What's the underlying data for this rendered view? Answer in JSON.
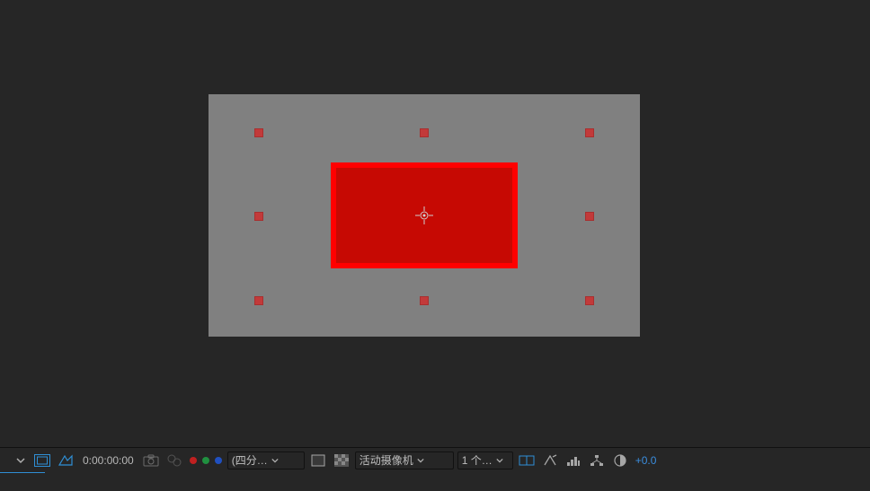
{
  "viewer": {
    "comp_bg": "#808080",
    "solid_fill": "#c60903",
    "solid_stroke": "#ff0000"
  },
  "footer": {
    "timecode": "0:00:00:00",
    "resolution_label": "(四分…",
    "camera_label": "活动摄像机",
    "views_label": "1 个…",
    "exposure": "+0.0",
    "dots": {
      "red": "#c02020",
      "green": "#209040",
      "blue": "#2050c0"
    }
  }
}
